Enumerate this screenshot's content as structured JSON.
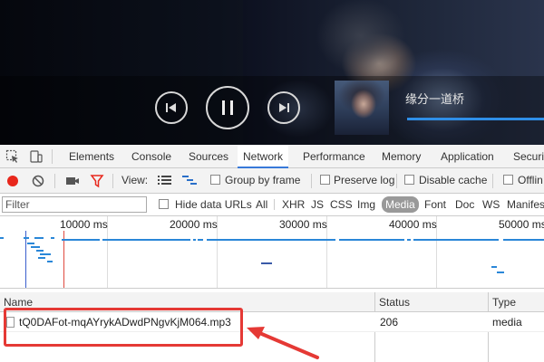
{
  "player": {
    "song_title": "缘分一道桥",
    "state": "playing",
    "progress_bar_color": "#2f8fe8",
    "controls": [
      "previous-icon",
      "pause-icon",
      "next-icon"
    ]
  },
  "devtools": {
    "main_tabs": [
      "Elements",
      "Console",
      "Sources",
      "Network",
      "Performance",
      "Memory",
      "Application",
      "Securi"
    ],
    "active_tab": "Network",
    "toolbar": {
      "view_label": "View:",
      "group_by_frame": "Group by frame",
      "preserve_log": "Preserve log",
      "disable_cache": "Disable cache",
      "offline": "Offlin"
    },
    "filter": {
      "placeholder": "Filter",
      "hide_data_urls": "Hide data URLs",
      "types": [
        "All",
        "XHR",
        "JS",
        "CSS",
        "Img",
        "Media",
        "Font",
        "Doc",
        "WS",
        "Manifes"
      ],
      "active_type": "Media"
    },
    "timeline": {
      "ticks": [
        "10000 ms",
        "20000 ms",
        "30000 ms",
        "40000 ms",
        "50000 ms"
      ]
    },
    "table": {
      "columns": [
        "Name",
        "Status",
        "Type"
      ],
      "rows": [
        {
          "name": "tQ0DAFot-mqAYrykADwdPNgvKjM064.mp3",
          "status": "206",
          "type": "media"
        }
      ]
    }
  },
  "annotation": {
    "highlight_color": "#e53935"
  },
  "colors": {
    "accent_blue": "#3879d9",
    "record_red": "#e8271c"
  }
}
